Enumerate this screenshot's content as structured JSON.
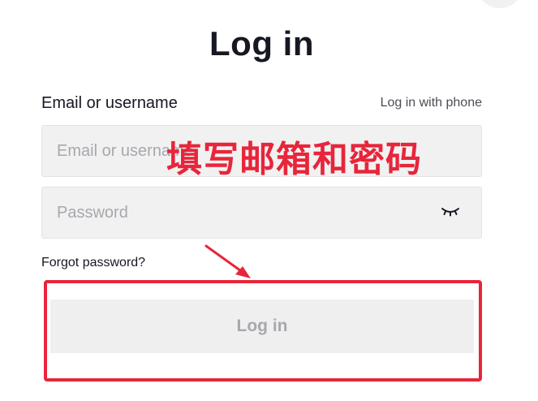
{
  "page": {
    "title": "Log in"
  },
  "form": {
    "email_label": "Email or username",
    "phone_link": "Log in with phone",
    "email_placeholder": "Email or username",
    "password_placeholder": "Password",
    "forgot_password": "Forgot password?",
    "submit_label": "Log in"
  },
  "annotation": {
    "text": "填写邮箱和密码",
    "color": "#e8253a"
  },
  "icons": {
    "password_toggle": "eye-closed-icon"
  }
}
